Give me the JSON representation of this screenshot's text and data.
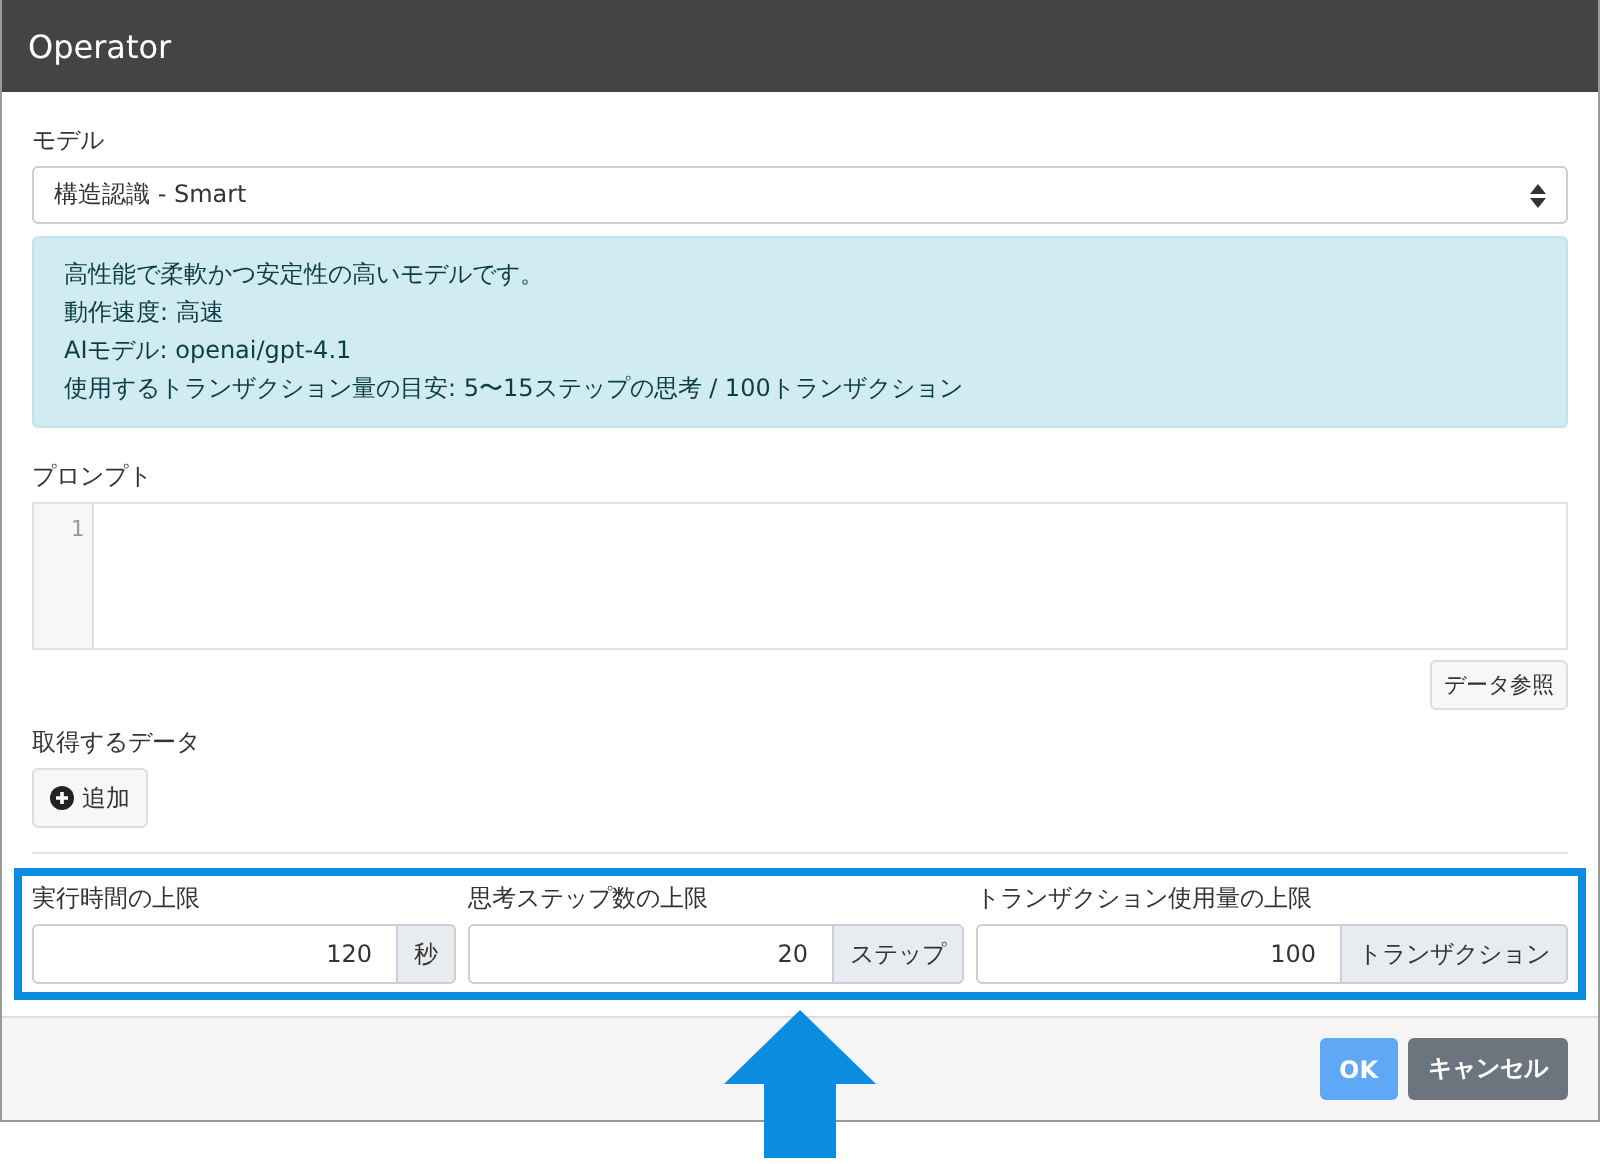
{
  "window": {
    "title": "Operator"
  },
  "model": {
    "label": "モデル",
    "value": "構造認識 - Smart"
  },
  "info": [
    "高性能で柔軟かつ安定性の高いモデルです。",
    "動作速度: 高速",
    "AIモデル: openai/gpt-4.1",
    "使用するトランザクション量の目安: 5〜15ステップの思考 / 100トランザクション"
  ],
  "prompt": {
    "label": "プロンプト",
    "line_numbers": [
      "1"
    ],
    "button": "データ参照"
  },
  "data": {
    "label": "取得するデータ",
    "add_button": "追加"
  },
  "limits": [
    {
      "label": "実行時間の上限",
      "value": "120",
      "unit": "秒"
    },
    {
      "label": "思考ステップ数の上限",
      "value": "20",
      "unit": "ステップ"
    },
    {
      "label": "トランザクション使用量の上限",
      "value": "100",
      "unit": "トランザクション"
    }
  ],
  "buttons": [
    {
      "label": "OK",
      "kind": "primary",
      "disabled": true
    },
    {
      "label": "キャンセル",
      "kind": "secondary",
      "disabled": false
    }
  ]
}
